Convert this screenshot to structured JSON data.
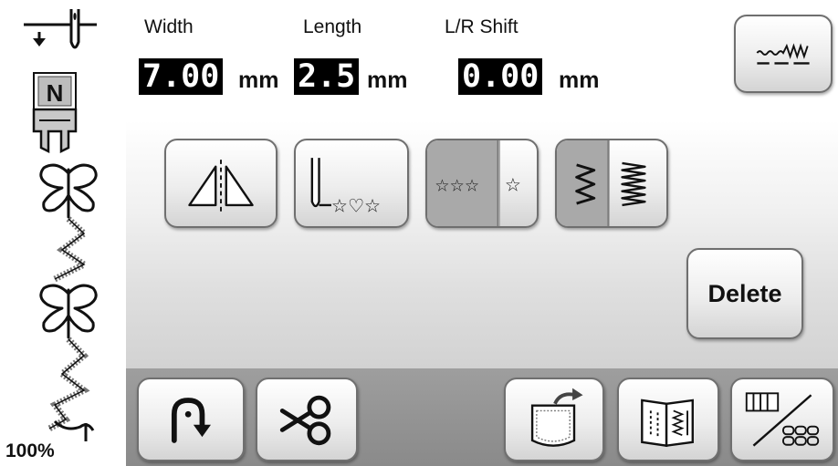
{
  "settings": {
    "width": {
      "label": "Width",
      "value": "7.00",
      "unit": "mm"
    },
    "length": {
      "label": "Length",
      "value": "2.5",
      "unit": "mm"
    },
    "shift": {
      "label": "L/R Shift",
      "value": "0.00",
      "unit": "mm"
    }
  },
  "preview": {
    "presser_foot": "N",
    "zoom": "100%"
  },
  "buttons": {
    "delete_label": "Delete"
  },
  "icons": {
    "needle_position": "needle-down-icon",
    "presser_foot": "presser-foot-n-icon",
    "stitch_preview": "butterfly-stitch-pattern",
    "image_check": "stitch-image-icon",
    "mirror": "mirror-icon",
    "needle_start": "needle-start-pattern-icon",
    "single_repeat": "single-repeat-icon",
    "density": "density-icon",
    "back": "back-arrow-icon",
    "cut": "scissors-icon",
    "pocket": "pocket-memory-icon",
    "manual": "sewing-chart-icon",
    "combination": "combination-icon"
  }
}
